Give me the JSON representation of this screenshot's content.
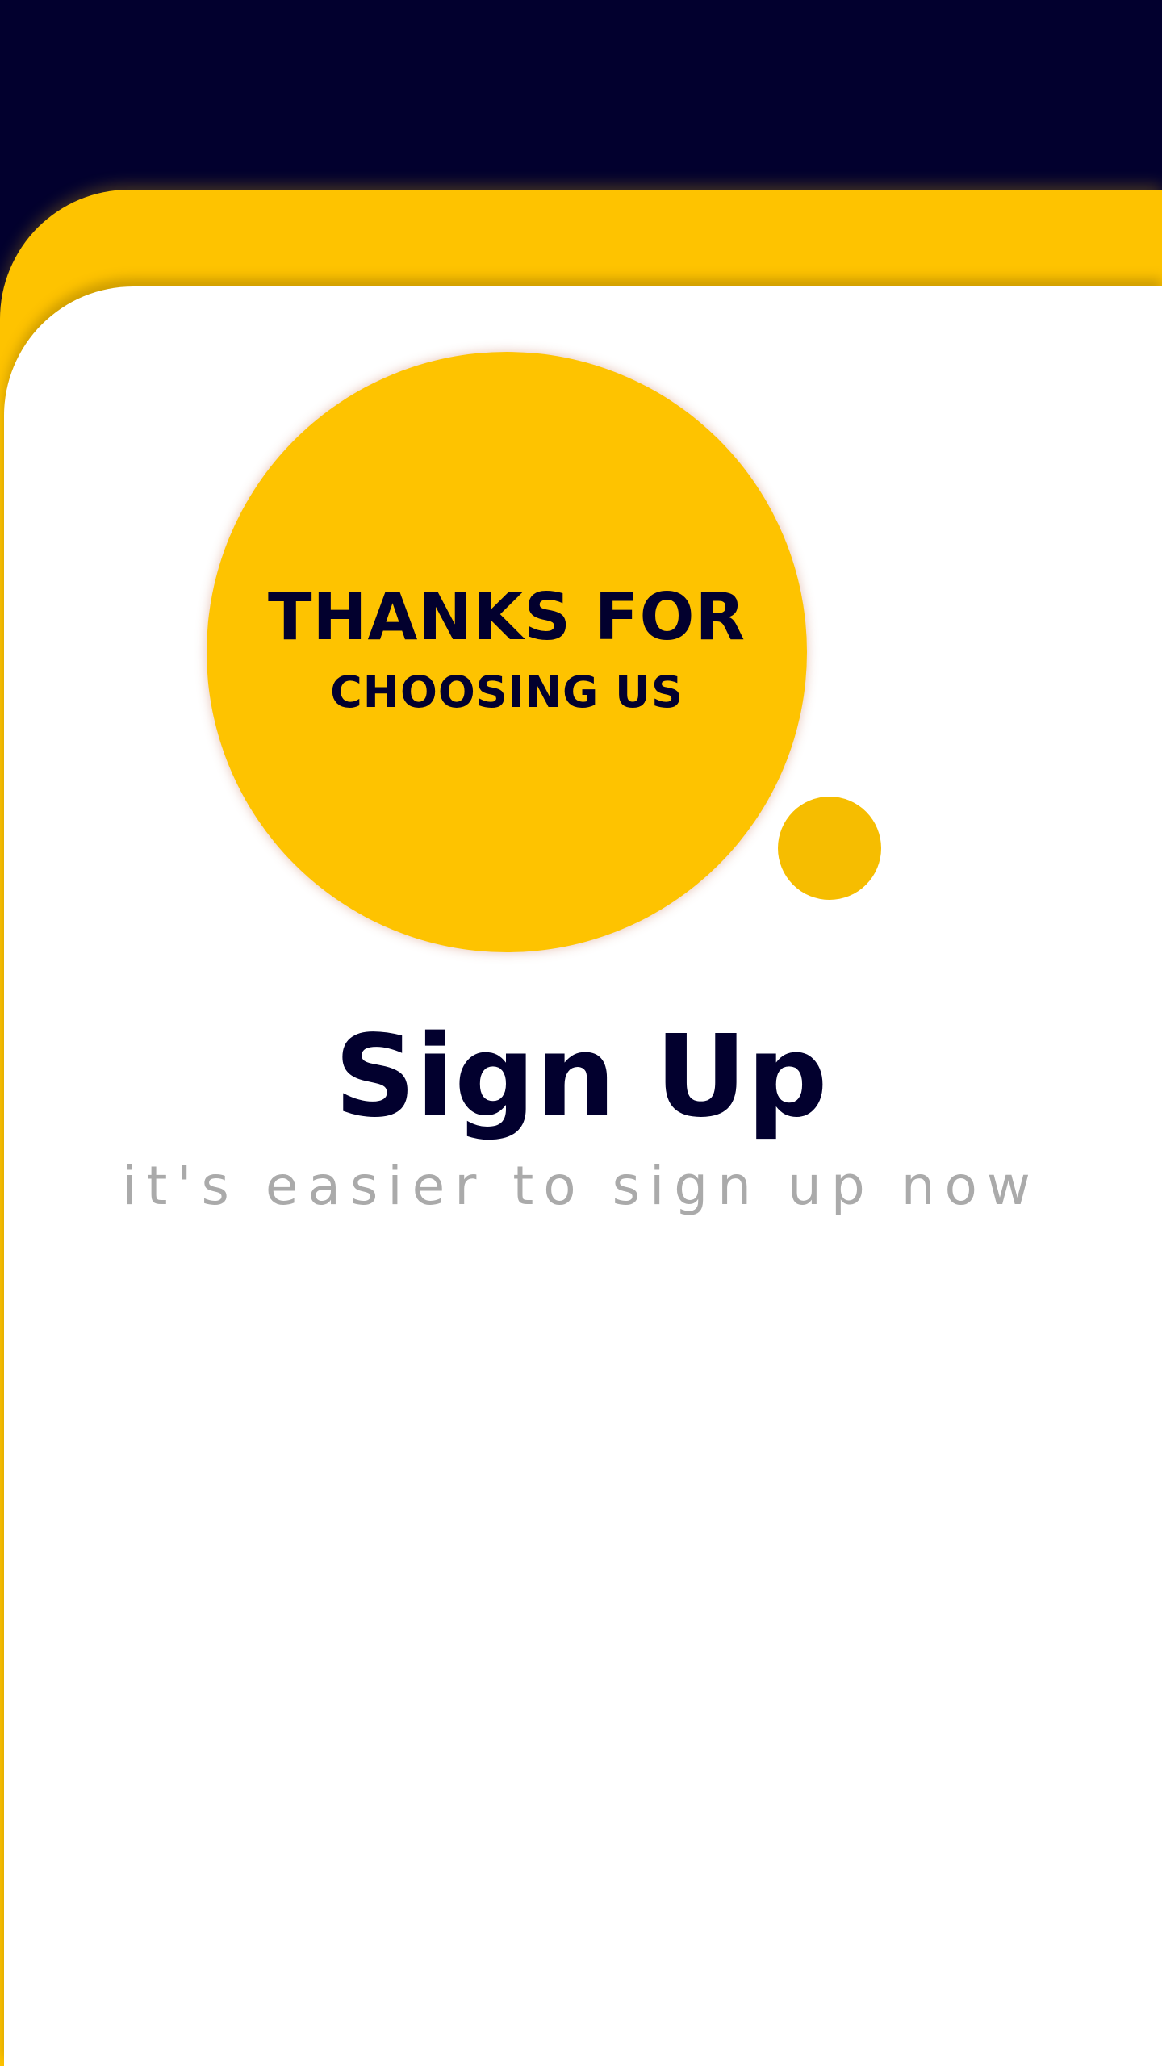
{
  "hero": {
    "line_1": "THANKS FOR",
    "line_2": "CHOOSING US"
  },
  "signup": {
    "title": "Sign Up",
    "subtitle": "it's easier to sign up now"
  },
  "colors": {
    "navy": "#02002e",
    "yellow": "#fec300",
    "subtitle_gray": "#aaaaaa",
    "card": "#ffffff"
  }
}
